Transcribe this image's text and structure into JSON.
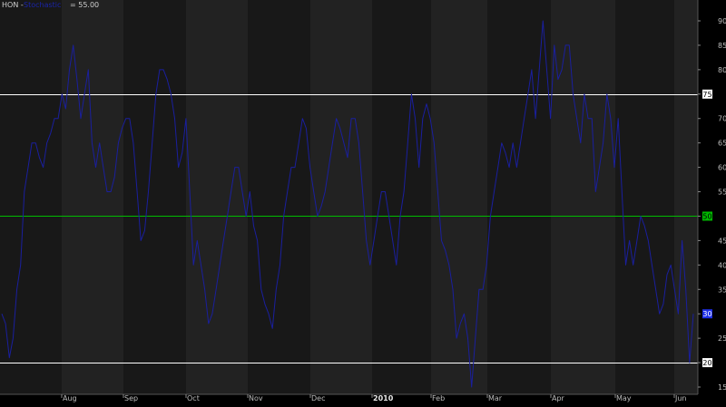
{
  "header": {
    "symbol": "HON -",
    "indicator": "Stochastic",
    "value_text": "= 55.00"
  },
  "colors": {
    "background": "#000000",
    "band_dark": "#181818",
    "band_light": "#222222",
    "series_line": "#1a1f9e",
    "upper_line": "#ffffff",
    "middle_line": "#00bb00",
    "lower_line": "#ffffff",
    "badge_last": "#1e2fe8",
    "badge_mid": "#00bb00",
    "badge_level": "#ffffff"
  },
  "chart_data": {
    "type": "line",
    "ylim": [
      13,
      93
    ],
    "yticks": [
      15,
      20,
      25,
      30,
      35,
      40,
      45,
      50,
      55,
      60,
      65,
      70,
      75,
      80,
      85,
      90
    ],
    "grid": false,
    "x_labels": [
      {
        "label": "Aug",
        "bold": false
      },
      {
        "label": "Sep",
        "bold": false
      },
      {
        "label": "Oct",
        "bold": false
      },
      {
        "label": "Nov",
        "bold": false
      },
      {
        "label": "Dec",
        "bold": false
      },
      {
        "label": "2010",
        "bold": true
      },
      {
        "label": "Feb",
        "bold": false
      },
      {
        "label": "Mar",
        "bold": false
      },
      {
        "label": "Apr",
        "bold": false
      },
      {
        "label": "May",
        "bold": false
      },
      {
        "label": "Jun",
        "bold": false
      }
    ],
    "reference_lines": [
      {
        "value": 75,
        "label": "75",
        "role": "upper"
      },
      {
        "value": 50,
        "label": "50",
        "role": "middle"
      },
      {
        "value": 20,
        "label": "20",
        "role": "lower"
      }
    ],
    "last_value_label": "30",
    "last_value": 30,
    "series": [
      {
        "values": [
          30,
          28,
          21,
          25,
          35,
          40,
          55,
          60,
          65,
          65,
          62,
          60,
          65,
          67,
          70,
          70,
          75,
          72,
          80,
          85,
          78,
          70,
          75,
          80,
          65,
          60,
          65,
          60,
          55,
          55,
          58,
          65,
          68,
          70,
          70,
          65,
          55,
          45,
          47,
          55,
          65,
          75,
          80,
          80,
          78,
          75,
          70,
          60,
          63,
          70,
          55,
          40,
          45,
          40,
          35,
          28,
          30,
          35,
          40,
          45,
          50,
          55,
          60,
          60,
          55,
          50,
          55,
          48,
          45,
          35,
          32,
          30,
          27,
          35,
          40,
          50,
          55,
          60,
          60,
          65,
          70,
          68,
          60,
          55,
          50,
          52,
          55,
          60,
          65,
          70,
          68,
          65,
          62,
          70,
          70,
          65,
          55,
          45,
          40,
          45,
          50,
          55,
          55,
          50,
          45,
          40,
          50,
          55,
          65,
          75,
          70,
          60,
          70,
          73,
          70,
          65,
          55,
          45,
          43,
          40,
          35,
          25,
          28,
          30,
          25,
          15,
          25,
          35,
          35,
          40,
          50,
          55,
          60,
          65,
          63,
          60,
          65,
          60,
          65,
          70,
          75,
          80,
          70,
          80,
          90,
          80,
          70,
          85,
          78,
          80,
          85,
          85,
          75,
          70,
          65,
          75,
          70,
          70,
          55,
          60,
          65,
          75,
          70,
          60,
          70,
          55,
          40,
          45,
          40,
          45,
          50,
          48,
          45,
          40,
          35,
          30,
          32,
          38,
          40,
          35,
          30,
          45,
          35,
          20,
          30
        ],
        "stroke_width": 1
      }
    ]
  }
}
